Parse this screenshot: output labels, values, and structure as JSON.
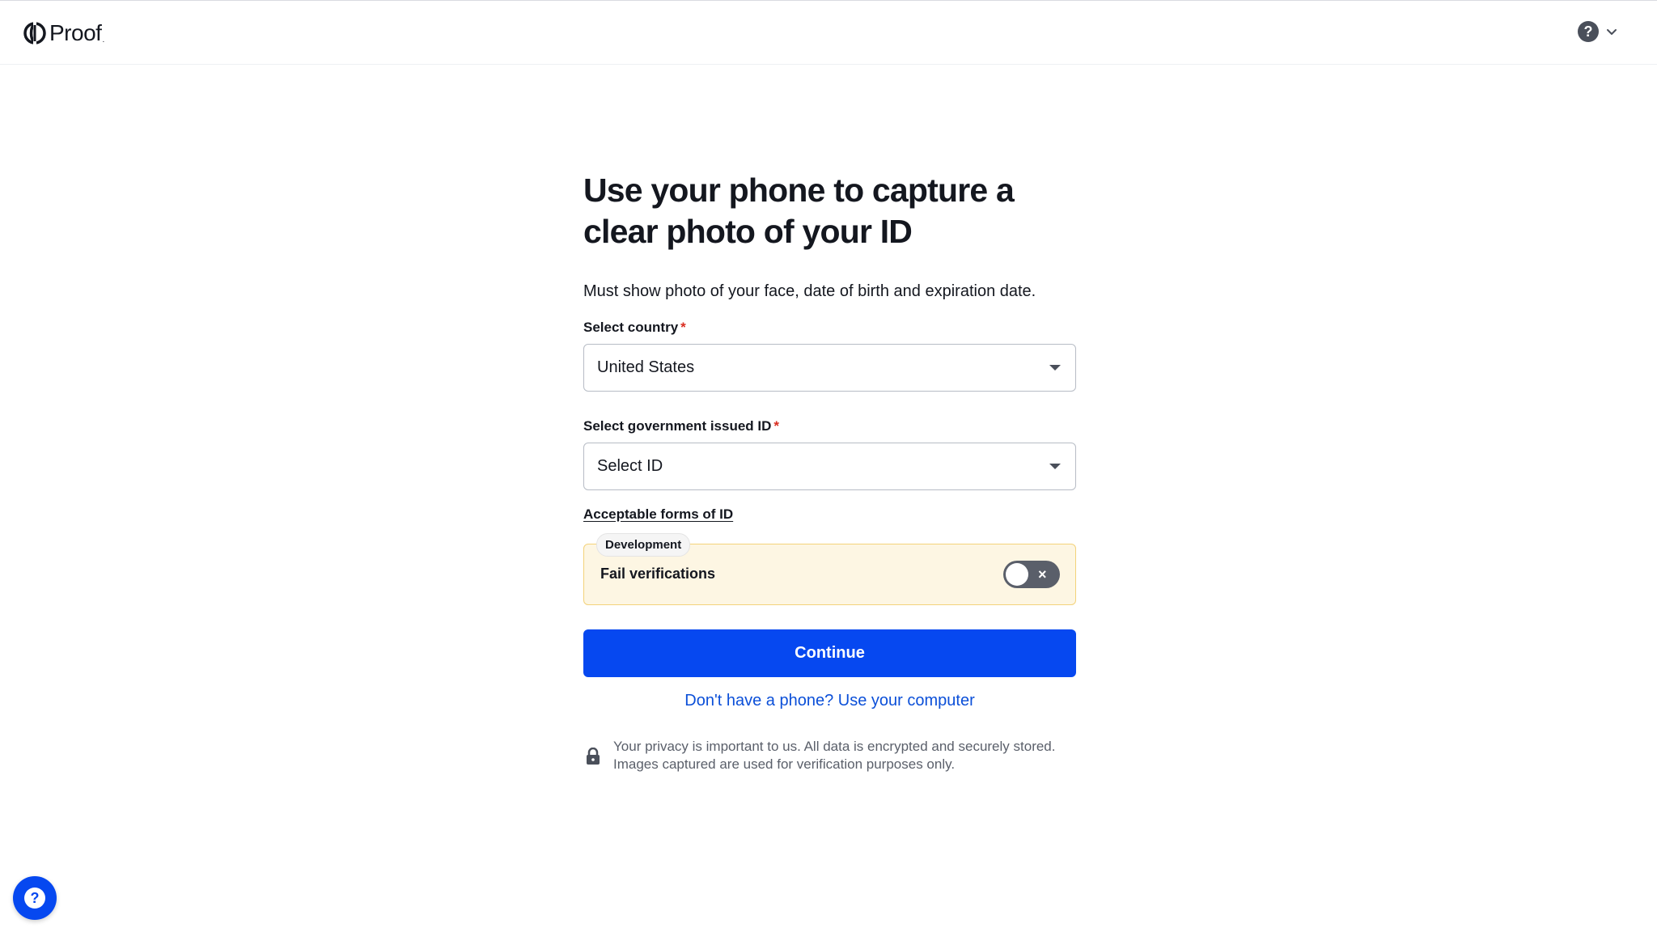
{
  "header": {
    "logo_text": "Proof",
    "logo_dot": ".",
    "help_icon": "question-circle-icon",
    "chevron_icon": "chevron-down-icon"
  },
  "main": {
    "title": "Use your phone to capture a clear photo of your ID",
    "subtitle": "Must show photo of your face, date of birth and expiration date.",
    "country": {
      "label": "Select country",
      "required_mark": "*",
      "value": "United States"
    },
    "gov_id": {
      "label": "Select government issued ID",
      "required_mark": "*",
      "value": "Select ID"
    },
    "acceptable_link": "Acceptable forms of ID",
    "dev": {
      "badge": "Development",
      "label": "Fail verifications",
      "toggle_on": false,
      "toggle_symbol": "×"
    },
    "continue_label": "Continue",
    "alt_link": "Don't have a phone? Use your computer",
    "privacy": "Your privacy is important to us. All data is encrypted and securely stored. Images captured are used for verification purposes only."
  },
  "fab": {
    "symbol": "?"
  },
  "colors": {
    "primary": "#0648f0",
    "link": "#0b4fd8",
    "required": "#d92d20",
    "dev_bg": "#fdf6e3",
    "dev_border": "#f3d27a"
  }
}
